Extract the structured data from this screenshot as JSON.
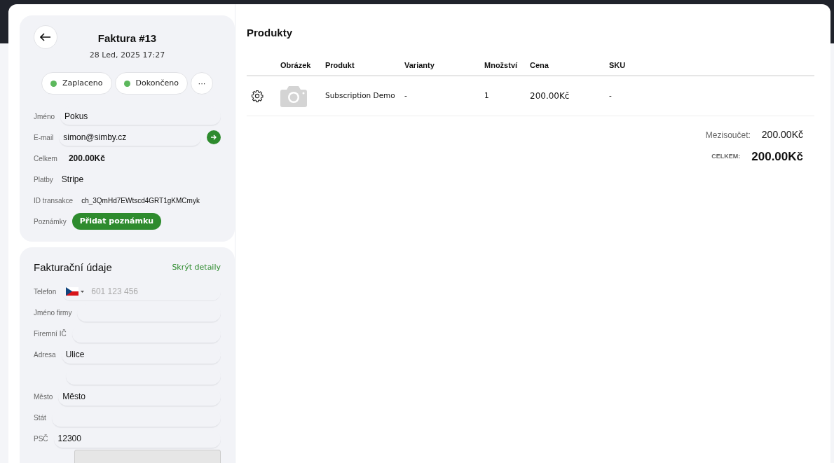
{
  "invoice": {
    "title": "Faktura #13",
    "date": "28 Led, 2025 17:27",
    "statuses": [
      {
        "label": "Zaplaceno",
        "color": "#5cb85c"
      },
      {
        "label": "Dokončeno",
        "color": "#5cb85c"
      }
    ],
    "more": "···",
    "fields": [
      {
        "kind": "input",
        "label": "Jméno",
        "value": "Pokus"
      },
      {
        "kind": "email",
        "label": "E-mail",
        "value": "simon@simby.cz"
      },
      {
        "kind": "bold",
        "label": "Celkem",
        "value": "200.00Kč"
      },
      {
        "kind": "text",
        "label": "Platby",
        "value": "Stripe"
      },
      {
        "kind": "small",
        "label": "ID transakce",
        "value": "ch_3QmHd7EWtscd4GRT1gKMCmyk"
      },
      {
        "kind": "button",
        "label": "Poznámky",
        "value": "Přidat poznámku"
      }
    ]
  },
  "billing": {
    "title": "Fakturační údaje",
    "toggle": "Skrýt detaily",
    "fields": [
      {
        "kind": "phone",
        "label": "Telefon",
        "placeholder": "601 123 456"
      },
      {
        "kind": "input",
        "label": "Jméno firmy"
      },
      {
        "kind": "input",
        "label": "Firemní IČ"
      },
      {
        "kind": "input",
        "label": "Adresa",
        "value": "Ulice"
      },
      {
        "kind": "input"
      },
      {
        "kind": "input",
        "label": "Město",
        "value": "Město"
      },
      {
        "kind": "input",
        "label": "Stát"
      },
      {
        "kind": "input",
        "label": "PSČ",
        "value": "12300"
      },
      {
        "kind": "select"
      }
    ]
  },
  "products": {
    "title": "Produkty",
    "columns": [
      "Obrázek",
      "Produkt",
      "Varianty",
      "Množství",
      "Cena",
      "SKU"
    ],
    "rows": [
      {
        "product": "Subscription Demo",
        "variants": "-",
        "quantity": "1",
        "price": "200.00Kč",
        "sku": "-"
      }
    ],
    "subtotal_label": "Mezisoučet:",
    "subtotal": "200.00Kč",
    "total_label": "CELKEM:",
    "total": "200.00Kč"
  }
}
